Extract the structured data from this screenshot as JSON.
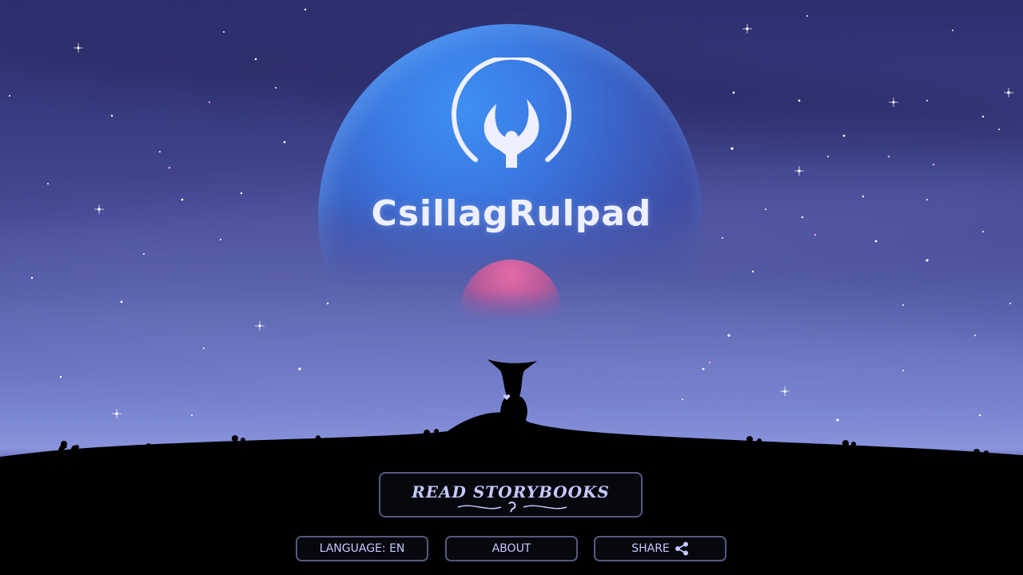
{
  "game": {
    "title": "CsillagRulpad"
  },
  "menu": {
    "read_label": "READ STORYBOOKS",
    "language_label": "LANGUAGE: EN",
    "about_label": "ABOUT",
    "share_label": "SHARE"
  },
  "icons": {
    "logo": "emblem-hands-icon",
    "share": "share-icon",
    "flourish": "ornament-icon"
  },
  "colors": {
    "sky_top": "#2d2e6e",
    "sky_horizon": "#8a93dc",
    "planet_big": "#3a7ce4",
    "planet_small": "#e46aa5",
    "button_text": "#c4caff",
    "button_border": "#55597f"
  }
}
